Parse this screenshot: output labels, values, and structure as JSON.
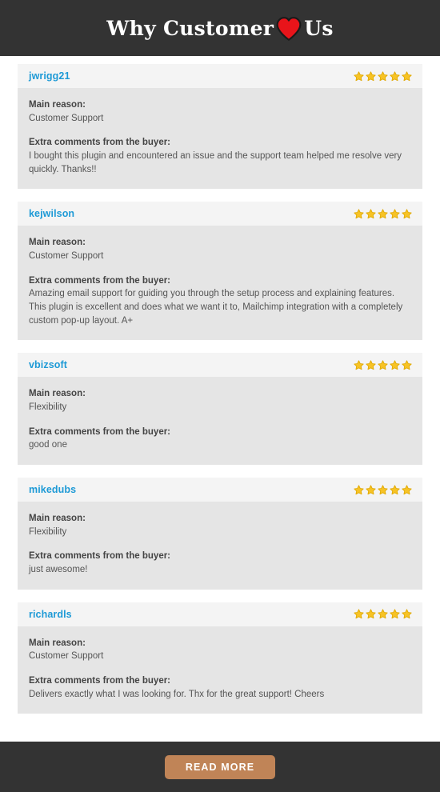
{
  "header": {
    "title_before": "Why Customer",
    "title_after": "Us",
    "heart_icon": "red-heart-icon",
    "background_color": "#333333",
    "text_color": "#ffffff"
  },
  "labels": {
    "main_reason": "Main reason:",
    "extra_comments": "Extra comments from the buyer:"
  },
  "colors": {
    "username": "#1e9ad6",
    "star": "#f7c325",
    "card_header_bg": "#f4f4f4",
    "card_body_bg": "#e5e5e5",
    "button_bg": "#c08457",
    "dark_bar": "#333333"
  },
  "reviews": [
    {
      "username": "jwrigg21",
      "rating": 5,
      "main_reason": "Customer Support",
      "comment": "I bought this plugin and encountered an issue and the support team helped me resolve very quickly. Thanks!!"
    },
    {
      "username": "kejwilson",
      "rating": 5,
      "main_reason": "Customer Support",
      "comment": "Amazing email support for guiding you through the setup process and explaining features. This plugin is excellent and does what we want it to, Mailchimp integration with a completely custom pop-up layout. A+"
    },
    {
      "username": "vbizsoft",
      "rating": 5,
      "main_reason": "Flexibility",
      "comment": "good one"
    },
    {
      "username": "mikedubs",
      "rating": 5,
      "main_reason": "Flexibility",
      "comment": "just awesome!"
    },
    {
      "username": "richardls",
      "rating": 5,
      "main_reason": "Customer Support",
      "comment": "Delivers exactly what I was looking for. Thx for the great support! Cheers"
    }
  ],
  "footer": {
    "read_more_label": "Read More"
  }
}
